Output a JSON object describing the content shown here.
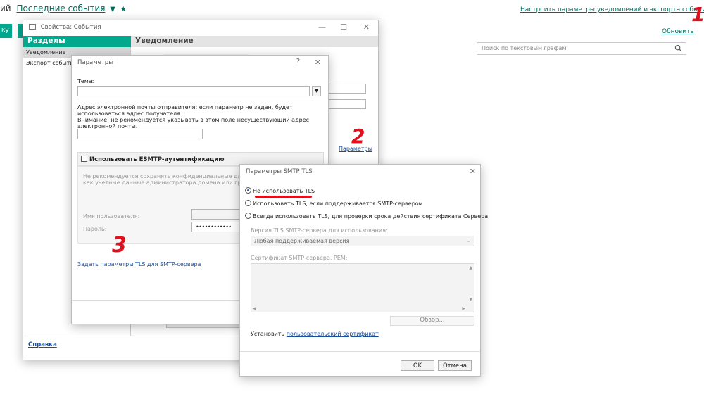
{
  "topbar": {
    "title_cut": "ий",
    "events_link": "Последние события",
    "dropdown_glyph": "▼",
    "star_glyph": "★",
    "settings_link": "Настроить параметры уведомлений и экспорта событий",
    "settings_arrow": "▼",
    "refresh_link": "Обновить",
    "search_placeholder": "Поиск по текстовым графам",
    "left_button_fragment": "ку"
  },
  "annotations": {
    "one": "1",
    "two": "2",
    "three": "3"
  },
  "props_window": {
    "title": "Свойства: События",
    "sections_header": "Разделы",
    "nav_items": [
      "Уведомление",
      "Экспорт событий"
    ],
    "main_header": "Уведомление",
    "params_link": "Параметры",
    "help_link": "Справка"
  },
  "params_dialog": {
    "title": "Параметры",
    "help_glyph": "?",
    "close_glyph": "✕",
    "subject_label": "Тема:",
    "sender_note_1": "Адрес электронной почты отправителя: если параметр не задан, будет использоваться адрес получателя.",
    "sender_note_2": "Внимание: не рекомендуется указывать в этом поле несуществующий адрес электронной почты.",
    "esmtp_label": "Использовать ESMTP-аутентификацию",
    "esmtp_note_1": "Не рекомендуется сохранять конфиденциальные данные, относ",
    "esmtp_note_2": "как учетные данные администратора домена или группы адми",
    "username_label": "Имя пользователя:",
    "password_label": "Пароль:",
    "password_value": "••••••••••••",
    "tls_link": "Задать параметры TLS для SMTP-сервера"
  },
  "tls_dialog": {
    "title": "Параметры SMTP TLS",
    "close_glyph": "✕",
    "options": [
      "Не использовать TLS",
      "Использовать TLS, если поддерживается SMTP-сервером",
      "Всегда использовать TLS, для проверки срока действия сертификата Сервера:"
    ],
    "selected_option": 0,
    "version_label": "Версия TLS SMTP-сервера для использования:",
    "version_value": "Любая поддерживаемая версия",
    "cert_label": "Сертификат SMTP-сервера, PEM:",
    "browse_button": "Обзор...",
    "install_prefix": "Установить",
    "install_link": "пользовательский сертификат",
    "ok_button": "OK",
    "cancel_button": "Отмена"
  },
  "colors": {
    "accent": "#00a88e",
    "link": "#006d5b",
    "annotation": "#e1101e",
    "radio_selected": "#1a5fb4"
  }
}
